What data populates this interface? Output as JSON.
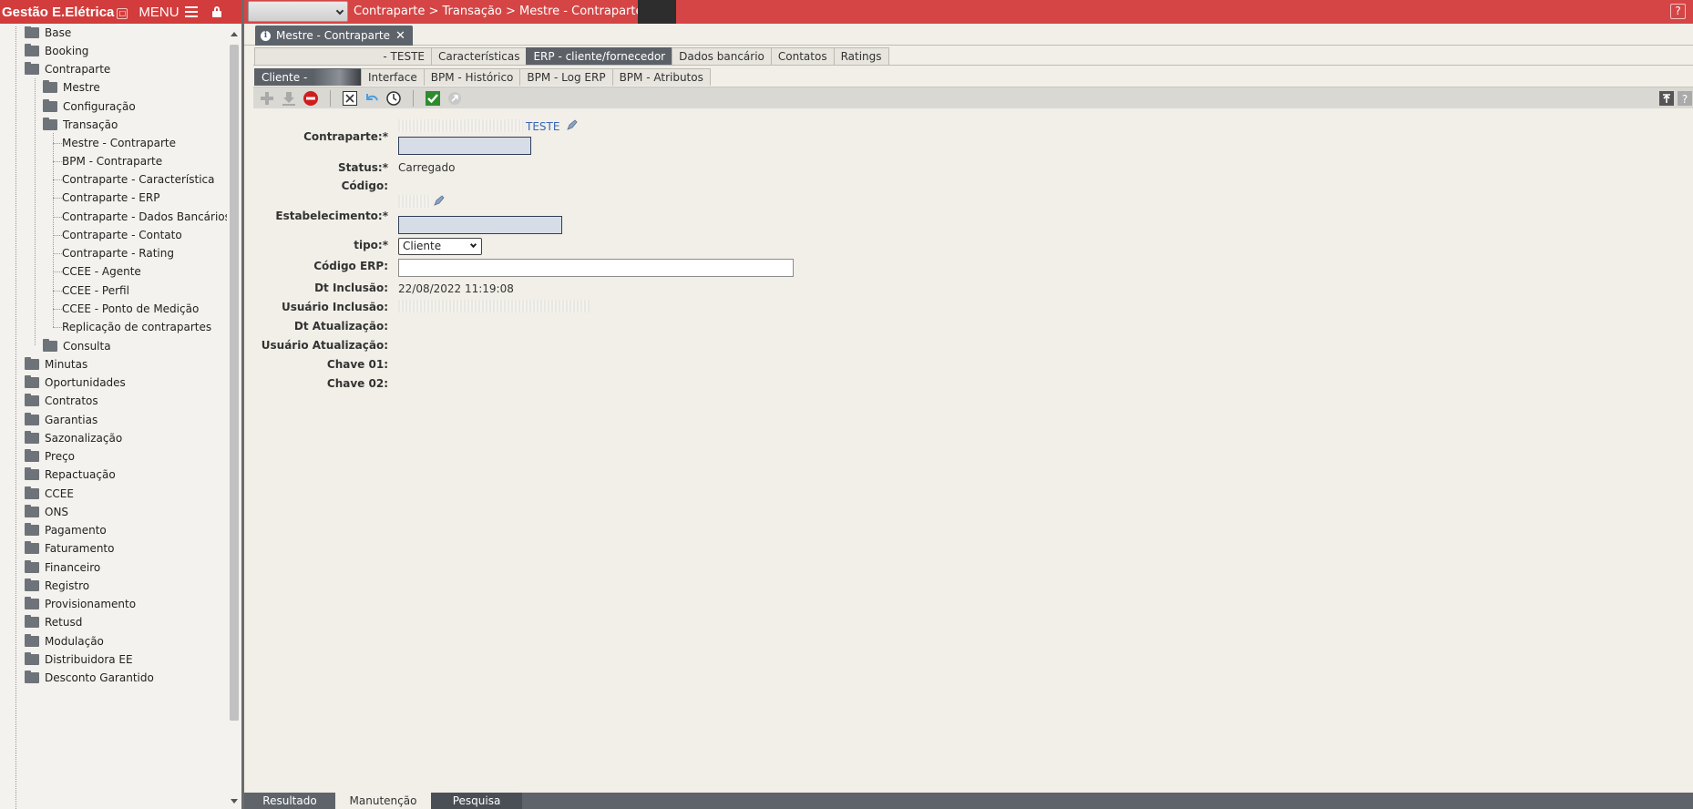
{
  "sidebar": {
    "brand": "Gestão E.Elétrica",
    "menu_label": "MENU",
    "items": [
      {
        "label": "Base",
        "level": 1
      },
      {
        "label": "Booking",
        "level": 1
      },
      {
        "label": "Contraparte",
        "level": 1
      },
      {
        "label": "Mestre",
        "level": 2
      },
      {
        "label": "Configuração",
        "level": 2
      },
      {
        "label": "Transação",
        "level": 2
      },
      {
        "label": "Mestre - Contraparte",
        "level": 3
      },
      {
        "label": "BPM - Contraparte",
        "level": 3
      },
      {
        "label": "Contraparte - Característica",
        "level": 3
      },
      {
        "label": "Contraparte - ERP",
        "level": 3
      },
      {
        "label": "Contraparte - Dados Bancários",
        "level": 3
      },
      {
        "label": "Contraparte - Contato",
        "level": 3
      },
      {
        "label": "Contraparte - Rating",
        "level": 3
      },
      {
        "label": "CCEE - Agente",
        "level": 3
      },
      {
        "label": "CCEE - Perfil",
        "level": 3
      },
      {
        "label": "CCEE - Ponto de Medição",
        "level": 3
      },
      {
        "label": "Replicação de contrapartes",
        "level": 3
      },
      {
        "label": "Consulta",
        "level": 2
      },
      {
        "label": "Minutas",
        "level": 1
      },
      {
        "label": "Oportunidades",
        "level": 1
      },
      {
        "label": "Contratos",
        "level": 1
      },
      {
        "label": "Garantias",
        "level": 1
      },
      {
        "label": "Sazonalização",
        "level": 1
      },
      {
        "label": "Preço",
        "level": 1
      },
      {
        "label": "Repactuação",
        "level": 1
      },
      {
        "label": "CCEE",
        "level": 1
      },
      {
        "label": "ONS",
        "level": 1
      },
      {
        "label": "Pagamento",
        "level": 1
      },
      {
        "label": "Faturamento",
        "level": 1
      },
      {
        "label": "Financeiro",
        "level": 1
      },
      {
        "label": "Registro",
        "level": 1
      },
      {
        "label": "Provisionamento",
        "level": 1
      },
      {
        "label": "Retusd",
        "level": 1
      },
      {
        "label": "Modulação",
        "level": 1
      },
      {
        "label": "Distribuidora EE",
        "level": 1
      },
      {
        "label": "Desconto Garantido",
        "level": 1
      }
    ]
  },
  "header": {
    "breadcrumb": "Contraparte > Transação > Mestre - Contraparte >",
    "help": "?"
  },
  "doc_tab": {
    "label": "Mestre - Contraparte",
    "close": "✕"
  },
  "subtabs_row1": [
    {
      "label": "- TESTE",
      "active": false
    },
    {
      "label": "Características",
      "active": false
    },
    {
      "label": "ERP - cliente/fornecedor",
      "active": true
    },
    {
      "label": "Dados bancário",
      "active": false
    },
    {
      "label": "Contatos",
      "active": false
    },
    {
      "label": "Ratings",
      "active": false
    }
  ],
  "subtabs_row2": [
    {
      "label": "Cliente -",
      "active": true
    },
    {
      "label": "Interface",
      "active": false
    },
    {
      "label": "BPM - Histórico",
      "active": false
    },
    {
      "label": "BPM - Log ERP",
      "active": false
    },
    {
      "label": "BPM - Atributos",
      "active": false
    }
  ],
  "form": {
    "contraparte_label": "Contraparte:*",
    "contraparte_name": "TESTE",
    "status_label": "Status:*",
    "status_value": "Carregado",
    "codigo_label": "Código:",
    "estabelecimento_label": "Estabelecimento:*",
    "tipo_label": "tipo:*",
    "tipo_value": "Cliente",
    "codigo_erp_label": "Código ERP:",
    "codigo_erp_value": "",
    "dt_inclusao_label": "Dt Inclusão:",
    "dt_inclusao_value": "22/08/2022 11:19:08",
    "usuario_inclusao_label": "Usuário Inclusão:",
    "dt_atualizacao_label": "Dt Atualização:",
    "usuario_atualizacao_label": "Usuário Atualização:",
    "chave01_label": "Chave 01:",
    "chave02_label": "Chave 02:"
  },
  "bottom_tabs": [
    {
      "label": "Resultado",
      "active": false
    },
    {
      "label": "Manutenção",
      "active": true
    },
    {
      "label": "Pesquisa",
      "active": false
    }
  ],
  "colors": {
    "brand_red": "#d23c3c",
    "active_tab": "#5c6168",
    "link_blue": "#3a66b7"
  }
}
